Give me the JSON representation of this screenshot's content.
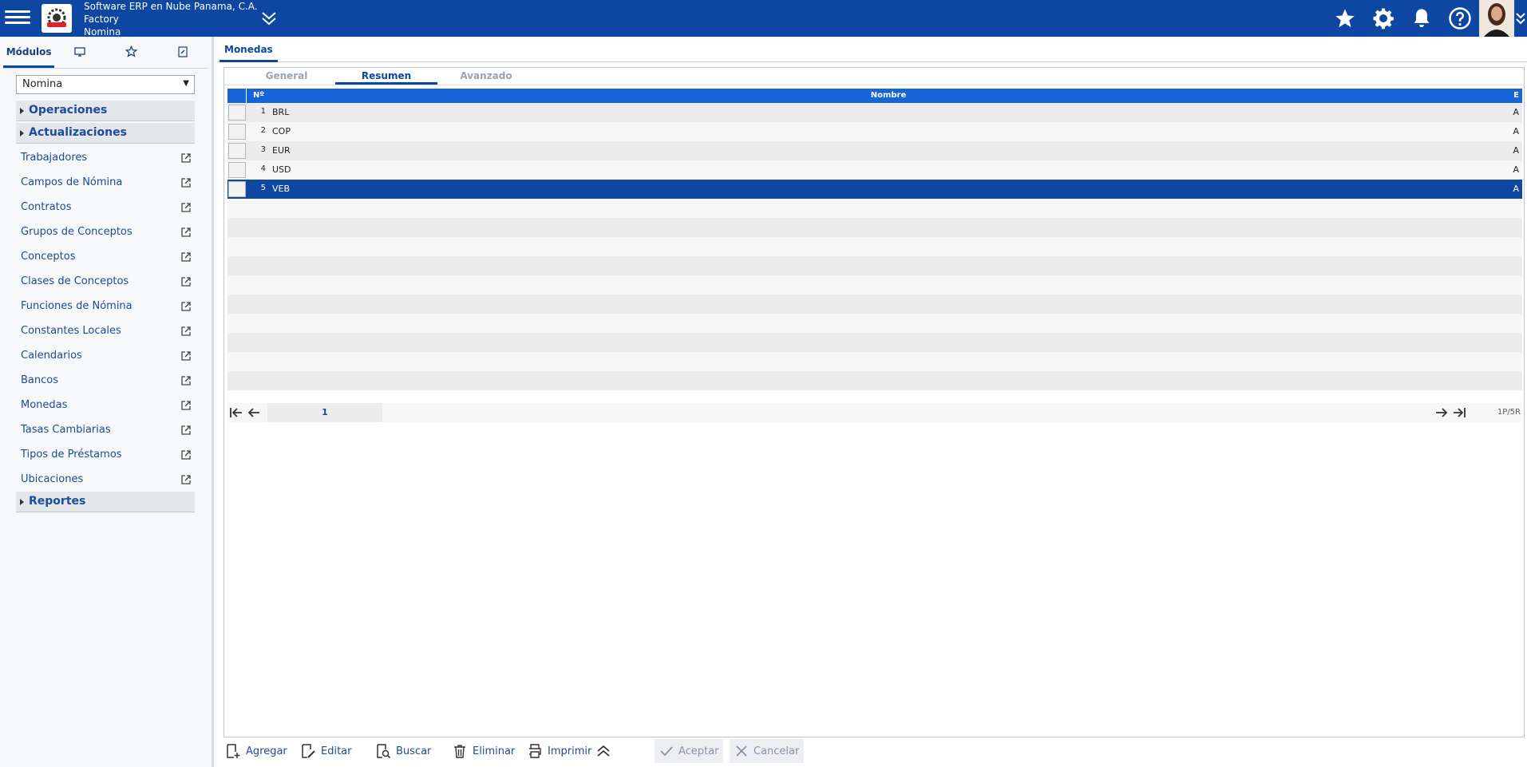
{
  "header": {
    "company_line1": "Software ERP en Nube Panama, C.A.",
    "company_line2": "Factory",
    "company_line3": "Nomina"
  },
  "sidebar": {
    "tabs": [
      "Módulos"
    ],
    "module_select": "Nomina",
    "groups": {
      "operaciones": "Operaciones",
      "actualizaciones": "Actualizaciones",
      "reportes": "Reportes"
    },
    "items": [
      "Trabajadores",
      "Campos de Nómina",
      "Contratos",
      "Grupos de Conceptos",
      "Conceptos",
      "Clases de Conceptos",
      "Funciones de Nómina",
      "Constantes Locales",
      "Calendarios",
      "Bancos",
      "Monedas",
      "Tasas Cambiarias",
      "Tipos de Préstamos",
      "Ubicaciones"
    ]
  },
  "main": {
    "tab": "Monedas",
    "sub_tabs": [
      "General",
      "Resumen",
      "Avanzado"
    ],
    "grid": {
      "headers": {
        "num": "Nº",
        "name": "Nombre",
        "estado": "E"
      },
      "rows": [
        {
          "num": "1",
          "name": "BRL",
          "estado": "A"
        },
        {
          "num": "2",
          "name": "COP",
          "estado": "A"
        },
        {
          "num": "3",
          "name": "EUR",
          "estado": "A"
        },
        {
          "num": "4",
          "name": "USD",
          "estado": "A"
        },
        {
          "num": "5",
          "name": "VEB",
          "estado": "A"
        }
      ]
    },
    "pager": {
      "page": "1",
      "info": "1P/5R"
    }
  },
  "toolbar": {
    "add": "Agregar",
    "edit": "Editar",
    "search": "Buscar",
    "delete": "Eliminar",
    "print": "Imprimir",
    "accept": "Aceptar",
    "cancel": "Cancelar"
  }
}
